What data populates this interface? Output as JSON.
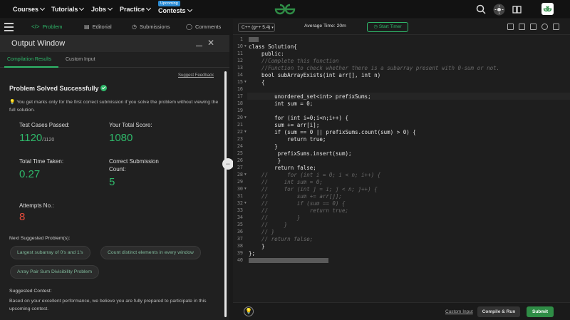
{
  "nav": {
    "items": [
      "Courses",
      "Tutorials",
      "Jobs",
      "Practice",
      "Contests"
    ],
    "upcoming_badge": "Upcoming",
    "logo_icon": "gfg-logo-icon"
  },
  "left_tabs": {
    "problem": "Problem",
    "editorial": "Editorial",
    "submissions": "Submissions",
    "comments": "Comments"
  },
  "output_window": {
    "title": "Output Window",
    "tabs": [
      "Compilation Results",
      "Custom Input"
    ],
    "suggest_feedback": "Suggest Feedback",
    "status": "Problem Solved Successfully",
    "marks_note": "You get marks only for the first correct submission if you solve the problem without viewing the full solution.",
    "stats": {
      "test_cases_label": "Test Cases Passed:",
      "test_cases_value": "1120",
      "test_cases_total": "/1120",
      "score_label": "Your Total Score:",
      "score_value": "1080",
      "time_label": "Total Time Taken:",
      "time_value": "0.27",
      "count_label_1": "Correct Submission",
      "count_label_2": "Count:",
      "count_value": "5",
      "attempts_label": "Attempts No.:",
      "attempts_value": "8"
    },
    "next_label": "Next Suggested Problem(s):",
    "suggested": [
      "Largest subarray of 0's and 1's",
      "Count distinct elements in every window",
      "Array Pair Sum Divisibility Problem"
    ],
    "contest_label": "Suggested Contest:",
    "contest_text": "Based on your excellent performance, we believe you are fully prepared to participate in this upcoming contest."
  },
  "editor": {
    "language": "C++ (g++ 5.4)",
    "average_time": "Average Time: 20m",
    "start_timer": "Start Timer",
    "line_numbers": [
      "1",
      "10",
      "11",
      "12",
      "13",
      "14",
      "15",
      "16",
      "17",
      "18",
      "19",
      "20",
      "21",
      "22",
      "23",
      "24",
      "25",
      "26",
      "27",
      "28",
      "29",
      "30",
      "31",
      "32",
      "33",
      "34",
      "35",
      "36",
      "37",
      "38",
      "39",
      "40"
    ],
    "lines": [
      "",
      "class Solution{",
      "    public:",
      "    //Complete this function",
      "    //Function to check whether there is a subarray present with 0-sum or not.",
      "    bool subArrayExists(int arr[], int n)",
      "    {",
      "",
      "        unordered_set<int> prefixSums;",
      "        int sum = 0;",
      "",
      "        for (int i=0;i<n;i++) {",
      "        sum += arr[i];",
      "        if (sum == 0 || prefixSums.count(sum) > 0) {",
      "            return true;",
      "        }",
      "         prefixSums.insert(sum);",
      "         }",
      "        return false;",
      "    //      for (int i = 0; i < n; i++) {",
      "    //     int sum = 0;",
      "    //     for (int j = i; j < n; j++) {",
      "    //         sum += arr[j];",
      "    //         if (sum == 0) {",
      "    //             return true;",
      "    //         }",
      "    //     }",
      "    // }",
      "    // return false;",
      "    }",
      "};",
      ""
    ],
    "custom_input": "Custom Input",
    "compile_run": "Compile & Run",
    "submit": "Submit"
  },
  "colors": {
    "accent_green": "#2fb86a",
    "submit_green": "#2f8d46",
    "error_red": "#e74c3c"
  }
}
